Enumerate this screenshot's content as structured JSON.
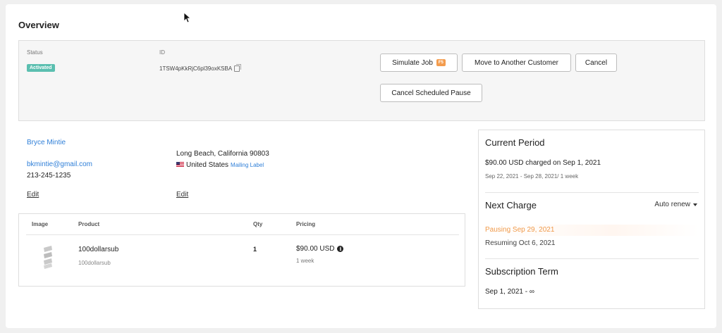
{
  "page": {
    "title": "Overview"
  },
  "overview": {
    "status_label": "Status",
    "status_value": "Activated",
    "id_label": "ID",
    "id_value": "1TSW4pKkRjC6pl39oxKSBA",
    "buttons": {
      "simulate_job": "Simulate Job",
      "simulate_job_key": "F5",
      "move_customer": "Move to Another Customer",
      "cancel": "Cancel",
      "cancel_pause": "Cancel Scheduled Pause"
    }
  },
  "customer": {
    "name": "Bryce Mintie",
    "email": "bkmintie@gmail.com",
    "phone": "213-245-1235",
    "edit_label": "Edit"
  },
  "address": {
    "city_line": "Long Beach, California 90803",
    "country": "United States",
    "mailing_label": "Mailing Label",
    "edit_label": "Edit"
  },
  "products": {
    "headers": {
      "image": "Image",
      "product": "Product",
      "qty": "Qty",
      "pricing": "Pricing"
    },
    "rows": [
      {
        "name": "100dollarsub",
        "sku": "100dollarsub",
        "qty": "1",
        "price": "$90.00 USD",
        "interval": "1 week"
      }
    ]
  },
  "sidebar": {
    "current_period": {
      "title": "Current Period",
      "charge": "$90.00 USD charged on Sep 1, 2021",
      "range": "Sep 22, 2021 - Sep 28, 2021/ 1 week"
    },
    "next_charge": {
      "title": "Next Charge",
      "auto_renew": "Auto renew",
      "pausing": "Pausing Sep 29, 2021",
      "resuming": "Resuming Oct 6, 2021"
    },
    "term": {
      "title": "Subscription Term",
      "value": "Sep 1, 2021 - ∞"
    }
  },
  "colors": {
    "accent_link": "#2f7fd8",
    "status_badge": "#5bbfb0",
    "shortcut_badge": "#f39c4e",
    "pausing_text": "#f09a4a"
  }
}
